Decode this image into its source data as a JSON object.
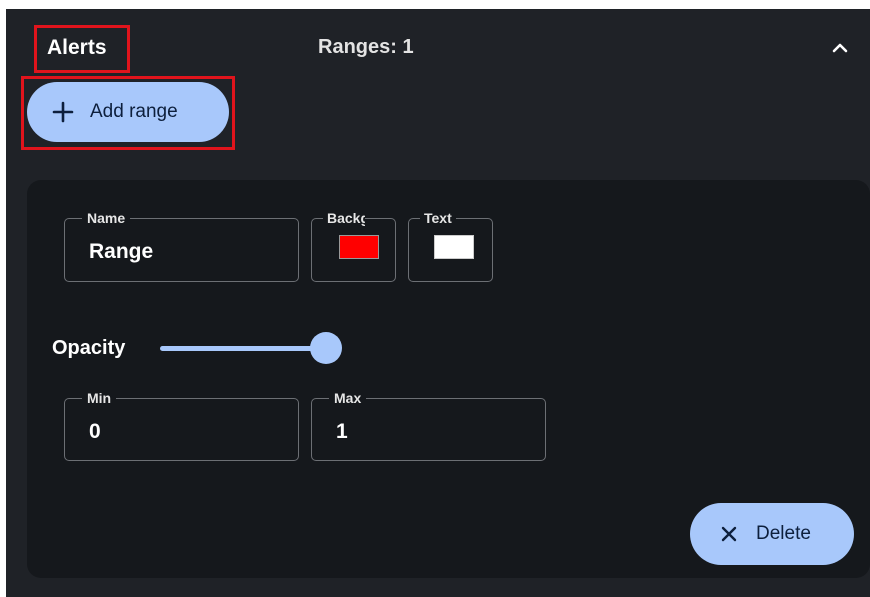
{
  "header": {
    "title": "Alerts",
    "ranges_count": "Ranges: 1",
    "collapse_icon": "chevron-up-icon"
  },
  "add_range": {
    "label": "Add range",
    "icon": "plus-icon"
  },
  "range": {
    "name_legend": "Name",
    "name_value": "Range",
    "background_legend": "Background",
    "background_color": "#ff0000",
    "text_legend": "Text",
    "text_color": "#ffffff",
    "opacity_label": "Opacity",
    "opacity_value": 1,
    "min_legend": "Min",
    "min_value": "0",
    "max_legend": "Max",
    "max_value": "1",
    "delete_label": "Delete",
    "delete_icon": "close-icon"
  },
  "colors": {
    "panel_bg": "#1f2227",
    "card_bg": "#15181c",
    "accent": "#a8c8fb",
    "highlight": "#e0141c"
  }
}
